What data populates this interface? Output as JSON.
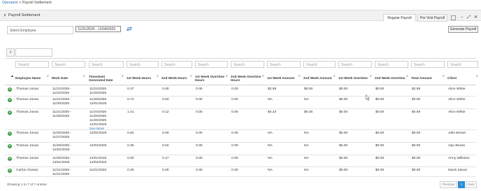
{
  "breadcrumb": {
    "parent": "Operation",
    "separator": ">",
    "current": "Payroll Settlement"
  },
  "panel": {
    "title": "Payroll Settlement"
  },
  "tabs": [
    "Regular Payroll",
    "Per Visit Payroll"
  ],
  "filters": {
    "employee_placeholder": "Select Employee",
    "date_range": "11/21/2025 - 12/04/2025",
    "generate_label": "Generate Payroll"
  },
  "grid": {
    "search_placeholder": "Search",
    "columns": [
      "Employee Name",
      "Work Date",
      "Timesheet Generated Date",
      "1st Week Hours",
      "2nd Week Hours",
      "1st Week Overtime Hours",
      "2nd Week Overtime Hours",
      "1st Week Amount",
      "2nd Week Amount",
      "1st Week Overtime",
      "2nd Week Overtime",
      "Total Amount",
      "Client"
    ],
    "see_more_label": "See More",
    "rows": [
      {
        "employee": "Thomas Jonas",
        "work_date": [
          "11/21/2025 -",
          "11/22/2025"
        ],
        "generated": [
          "11/24/2025",
          "11/25/2025"
        ],
        "w1h": "0.37",
        "w2h": "0.00",
        "w1oh": "0.00",
        "w2oh": "0.00",
        "w1a": "$2.59",
        "w2a": "$0.00",
        "w1o": "$0.00",
        "w2o": "$0.00",
        "total": "$2.59",
        "client": "Alice White"
      },
      {
        "employee": "Thomas Jonas",
        "work_date": [
          "11/21/2025 -",
          "11/30/2025"
        ],
        "generated": [
          "11/26/2025",
          "12/01/2025"
        ],
        "w1h": "0.74",
        "w2h": "0.50",
        "w1oh": "0.00",
        "w2oh": "0.00",
        "w1a": "NA",
        "w2a": "NA",
        "w1o": "$0.00",
        "w2o": "$0.00",
        "total": "$0.00",
        "client": "Alice White"
      },
      {
        "employee": "Thomas Jonas",
        "work_date": [
          "11/21/2025 -",
          "11/28/2025"
        ],
        "generated": [
          "11/24/2025",
          "11/25/2025",
          "11/26/2025",
          "12/01/2025"
        ],
        "more": true,
        "w1h": "1.41",
        "w2h": "0.12",
        "w1oh": "0.00",
        "w2oh": "0.00",
        "w1a": "$4.23",
        "w2a": "$0.36",
        "w1o": "$0.00",
        "w2o": "$0.00",
        "total": "$4.59",
        "client": "Alice White"
      },
      {
        "employee": "Thomas Jonas",
        "work_date": [
          "11/25/2025 -",
          "11/27/2025"
        ],
        "generated": [
          "12/02/2025"
        ],
        "w1h": "0.62",
        "w2h": "0.00",
        "w1oh": "0.00",
        "w2oh": "0.00",
        "w1a": "NA",
        "w2a": "NA",
        "w1o": "$0.00",
        "w2o": "$0.00",
        "total": "$0.00",
        "client": "Julie Brown"
      },
      {
        "employee": "Thomas Jonas",
        "work_date": [
          "11/26/2025 -",
          "12/02/2025"
        ],
        "generated": [
          "12/02/2025"
        ],
        "w1h": "0.25",
        "w2h": "0.02",
        "w1oh": "0.00",
        "w2oh": "0.00",
        "w1a": "NA",
        "w2a": "NA",
        "w1o": "$0.00",
        "w2o": "$0.00",
        "total": "$0.00",
        "client": "Jojo Brown"
      },
      {
        "employee": "Thomas Jonas",
        "work_date": [
          "11/30/2025 -",
          "12/01/2025"
        ],
        "generated": [
          "12/01/2025",
          "12/02/2025"
        ],
        "w1h": "0.00",
        "w2h": "0.17",
        "w1oh": "0.00",
        "w2oh": "0.00",
        "w1a": "NA",
        "w2a": "NA",
        "w1o": "$0.00",
        "w2o": "$0.00",
        "total": "$0.00",
        "client": "Anny Williams"
      },
      {
        "employee": "Carlos Alcaraz",
        "work_date": [
          "11/21/2025 -",
          "11/21/2025"
        ],
        "generated": [
          "11/21/2025"
        ],
        "w1h": "0.25",
        "w2h": "0.00",
        "w1oh": "0.00",
        "w2oh": "0.00",
        "w1a": "NA",
        "w2a": "NA",
        "w1o": "$0.00",
        "w2o": "$0.00",
        "total": "$0.00",
        "client": "Davis Zason"
      }
    ]
  },
  "footer": {
    "info": "Showing 1 to 7 of 7 entries",
    "pager": {
      "previous": "Previous",
      "page": "1",
      "next": "Next"
    }
  },
  "colors": {
    "link": "#2a6fba",
    "expand": "#3d9a45",
    "pager_active": "#2b8fd6"
  }
}
